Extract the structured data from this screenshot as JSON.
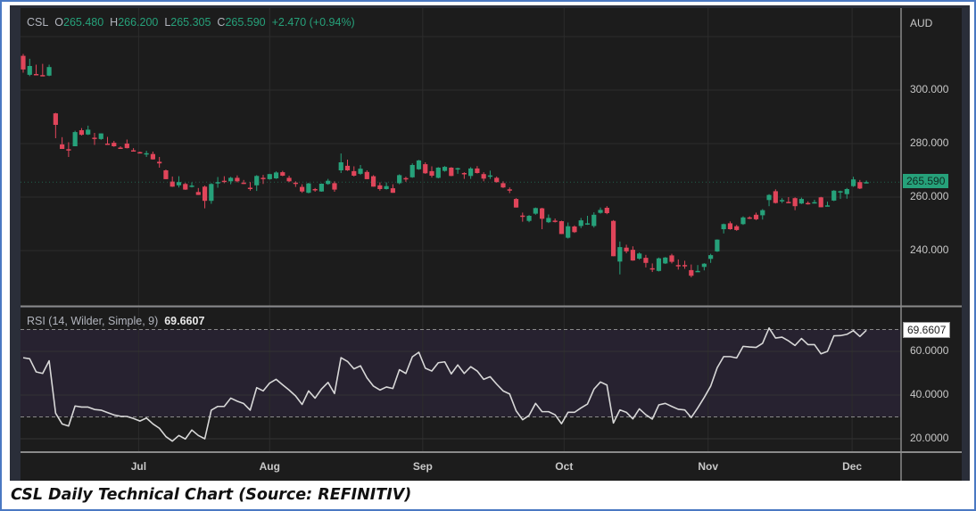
{
  "header": {
    "symbol": "CSL",
    "o_label": "O",
    "open": "265.480",
    "h_label": "H",
    "high": "266.200",
    "l_label": "L",
    "low": "265.305",
    "c_label": "C",
    "close": "265.590",
    "change": "+2.470 (+0.94%)"
  },
  "rsi_header": {
    "label": "RSI (14, Wilder, Simple, 9)",
    "value": "69.6607"
  },
  "caption": "CSL Daily Technical Chart (Source: REFINITIV)",
  "colors": {
    "up": "#26a17a",
    "down": "#e0455a",
    "rsi_line": "#d8d8d8",
    "band": "#272230",
    "bg": "#1c1c1c"
  },
  "chart_data": [
    {
      "type": "candlestick",
      "title": "CSL",
      "currency": "AUD",
      "ylabel": "AUD",
      "ylim": [
        222,
        328
      ],
      "yticks": [
        {
          "v": 300,
          "label": "300.000"
        },
        {
          "v": 280,
          "label": "280.000"
        },
        {
          "v": 260,
          "label": "260.000"
        },
        {
          "v": 240,
          "label": "240.000"
        }
      ],
      "last_price_label": "265.590",
      "last_price": 265.59,
      "xticks": [
        {
          "i": 17.8,
          "label": "Jul"
        },
        {
          "i": 38,
          "label": "Aug"
        },
        {
          "i": 61.6,
          "label": "Sep"
        },
        {
          "i": 83.4,
          "label": "Oct"
        },
        {
          "i": 105.6,
          "label": "Nov"
        },
        {
          "i": 127.8,
          "label": "Dec"
        }
      ],
      "ohlc": [
        [
          312.8,
          313.5,
          306.5,
          307.7
        ],
        [
          305.7,
          311.7,
          305.2,
          309.0
        ],
        [
          306.0,
          309.5,
          305.5,
          305.8
        ],
        [
          305.6,
          309.8,
          305.2,
          305.4
        ],
        [
          305.4,
          309.5,
          305.2,
          308.6
        ],
        [
          291.3,
          291.5,
          282.0,
          287.0
        ],
        [
          279.7,
          282.4,
          278.0,
          278.0
        ],
        [
          277.9,
          280.5,
          275.0,
          277.6
        ],
        [
          279.0,
          284.8,
          279.0,
          284.3
        ],
        [
          285.0,
          285.8,
          283.0,
          283.3
        ],
        [
          283.4,
          286.7,
          283.2,
          285.2
        ],
        [
          282.2,
          284.0,
          279.5,
          281.9
        ],
        [
          281.7,
          283.8,
          281.4,
          283.8
        ],
        [
          280.0,
          282.5,
          279.5,
          279.8
        ],
        [
          280.3,
          281.0,
          278.8,
          279.0
        ],
        [
          278.5,
          279.0,
          278.0,
          278.2
        ],
        [
          280.0,
          281.5,
          278.2,
          278.3
        ],
        [
          277.5,
          278.3,
          277.0,
          277.2
        ],
        [
          276.8,
          277.0,
          276.3,
          276.5
        ],
        [
          276.2,
          277.3,
          275.0,
          276.4
        ],
        [
          276.1,
          277.0,
          274.0,
          274.1
        ],
        [
          273.2,
          275.0,
          271.0,
          272.6
        ],
        [
          270.0,
          270.3,
          266.7,
          266.7
        ],
        [
          265.8,
          267.7,
          263.8,
          263.9
        ],
        [
          264.4,
          267.8,
          263.6,
          265.6
        ],
        [
          264.9,
          265.3,
          262.7,
          262.8
        ],
        [
          264.0,
          265.5,
          263.6,
          264.3
        ],
        [
          261.9,
          263.4,
          260.8,
          260.8
        ],
        [
          263.9,
          264.3,
          255.8,
          258.6
        ],
        [
          258.6,
          265.2,
          257.5,
          264.9
        ],
        [
          265.3,
          267.5,
          263.5,
          265.6
        ],
        [
          266.1,
          267.8,
          265.2,
          265.6
        ],
        [
          265.9,
          267.6,
          264.8,
          267.2
        ],
        [
          267.2,
          268.1,
          265.5,
          265.9
        ],
        [
          265.4,
          266.4,
          264.9,
          265.2
        ],
        [
          263.5,
          265.6,
          262.4,
          263.1
        ],
        [
          264.4,
          268.2,
          262.3,
          267.9
        ],
        [
          267.2,
          268.3,
          264.9,
          266.9
        ],
        [
          266.7,
          268.7,
          266.5,
          268.6
        ],
        [
          267.0,
          269.6,
          266.8,
          269.2
        ],
        [
          269.3,
          269.8,
          267.8,
          268.0
        ],
        [
          267.2,
          268.0,
          265.6,
          265.9
        ],
        [
          265.4,
          265.9,
          263.8,
          265.1
        ],
        [
          263.8,
          264.8,
          261.6,
          262.1
        ],
        [
          261.6,
          265.3,
          261.4,
          265.1
        ],
        [
          263.0,
          263.4,
          262.0,
          262.7
        ],
        [
          262.1,
          265.1,
          262.0,
          265.0
        ],
        [
          264.9,
          266.8,
          264.6,
          266.1
        ],
        [
          265.2,
          265.9,
          262.0,
          262.8
        ],
        [
          270.0,
          276.3,
          269.0,
          273.0
        ],
        [
          271.7,
          274.0,
          269.8,
          270.0
        ],
        [
          269.7,
          271.5,
          267.7,
          268.0
        ],
        [
          268.7,
          272.0,
          268.3,
          270.6
        ],
        [
          269.4,
          270.0,
          266.7,
          266.7
        ],
        [
          267.8,
          268.2,
          263.9,
          263.9
        ],
        [
          264.4,
          265.5,
          262.4,
          263.0
        ],
        [
          263.0,
          265.5,
          262.8,
          264.1
        ],
        [
          263.3,
          264.8,
          261.6,
          261.6
        ],
        [
          265.2,
          268.5,
          264.8,
          268.2
        ],
        [
          267.1,
          267.6,
          265.7,
          266.9
        ],
        [
          267.4,
          272.6,
          267.2,
          272.0
        ],
        [
          270.4,
          273.9,
          270.2,
          273.7
        ],
        [
          272.3,
          273.0,
          268.7,
          268.9
        ],
        [
          269.7,
          271.5,
          267.3,
          268.0
        ],
        [
          267.2,
          271.2,
          267.0,
          271.0
        ],
        [
          269.8,
          271.6,
          269.5,
          271.3
        ],
        [
          271.0,
          271.2,
          267.8,
          267.9
        ],
        [
          270.6,
          271.0,
          268.7,
          270.8
        ],
        [
          269.0,
          269.3,
          266.8,
          268.9
        ],
        [
          267.9,
          271.2,
          266.8,
          270.7
        ],
        [
          270.7,
          271.6,
          268.8,
          269.0
        ],
        [
          268.6,
          269.3,
          265.9,
          266.9
        ],
        [
          267.9,
          269.9,
          266.8,
          268.1
        ],
        [
          267.2,
          267.7,
          265.4,
          265.6
        ],
        [
          265.2,
          265.9,
          263.4,
          263.6
        ],
        [
          262.9,
          263.6,
          261.5,
          262.7
        ],
        [
          259.3,
          259.6,
          256.1,
          256.1
        ],
        [
          253.1,
          254.2,
          250.8,
          252.8
        ],
        [
          251.1,
          253.3,
          250.6,
          253.0
        ],
        [
          253.8,
          256.1,
          253.4,
          255.9
        ],
        [
          255.8,
          256.0,
          248.0,
          251.9
        ],
        [
          250.6,
          253.5,
          250.3,
          252.2
        ],
        [
          251.2,
          252.0,
          250.5,
          251.0
        ],
        [
          251.0,
          251.2,
          246.2,
          246.2
        ],
        [
          244.8,
          250.5,
          244.5,
          249.1
        ],
        [
          249.0,
          249.4,
          246.6,
          246.9
        ],
        [
          249.2,
          252.2,
          248.4,
          251.3
        ],
        [
          250.1,
          253.0,
          249.6,
          250.2
        ],
        [
          249.2,
          254.3,
          248.6,
          253.4
        ],
        [
          254.1,
          256.1,
          253.8,
          255.2
        ],
        [
          256.0,
          256.6,
          253.6,
          254.0
        ],
        [
          251.1,
          251.4,
          237.9,
          237.9
        ],
        [
          235.9,
          243.4,
          231.1,
          241.3
        ],
        [
          241.1,
          242.2,
          239.0,
          239.7
        ],
        [
          240.3,
          241.6,
          236.2,
          236.3
        ],
        [
          237.0,
          239.3,
          236.6,
          238.9
        ],
        [
          237.3,
          238.4,
          233.7,
          235.4
        ],
        [
          233.4,
          235.2,
          232.0,
          233.0
        ],
        [
          232.4,
          237.4,
          232.2,
          237.1
        ],
        [
          235.2,
          237.6,
          235.0,
          237.4
        ],
        [
          238.2,
          238.8,
          235.2,
          235.8
        ],
        [
          234.6,
          236.7,
          232.9,
          234.3
        ],
        [
          234.6,
          236.2,
          233.2,
          234.3
        ],
        [
          232.7,
          234.8,
          230.0,
          230.6
        ],
        [
          232.2,
          234.6,
          232.0,
          232.4
        ],
        [
          233.9,
          235.3,
          232.6,
          235.1
        ],
        [
          236.9,
          238.8,
          235.4,
          238.3
        ],
        [
          239.7,
          244.2,
          239.5,
          244.1
        ],
        [
          248.0,
          250.1,
          246.4,
          249.9
        ],
        [
          250.2,
          250.9,
          247.8,
          248.0
        ],
        [
          249.1,
          249.6,
          247.4,
          247.7
        ],
        [
          249.9,
          252.8,
          249.6,
          252.4
        ],
        [
          252.4,
          252.8,
          251.8,
          252.2
        ],
        [
          253.4,
          254.2,
          251.4,
          251.7
        ],
        [
          253.2,
          255.5,
          251.6,
          255.1
        ],
        [
          258.9,
          261.1,
          256.6,
          260.8
        ],
        [
          262.2,
          262.9,
          257.6,
          257.8
        ],
        [
          258.8,
          259.6,
          257.8,
          258.9
        ],
        [
          258.2,
          260.0,
          257.7,
          258.0
        ],
        [
          259.6,
          259.9,
          255.1,
          256.6
        ],
        [
          257.6,
          259.8,
          257.4,
          259.3
        ],
        [
          257.8,
          258.4,
          257.2,
          257.4
        ],
        [
          258.0,
          259.0,
          257.6,
          258.1
        ],
        [
          259.9,
          260.1,
          256.2,
          256.2
        ],
        [
          256.7,
          258.3,
          256.5,
          256.9
        ],
        [
          258.7,
          262.6,
          258.5,
          262.4
        ],
        [
          262.0,
          262.4,
          259.3,
          262.2
        ],
        [
          261.1,
          263.4,
          259.4,
          263.0
        ],
        [
          264.1,
          267.6,
          263.8,
          266.6
        ],
        [
          265.6,
          266.4,
          263.0,
          263.2
        ],
        [
          265.48,
          266.2,
          265.305,
          265.59
        ]
      ]
    },
    {
      "type": "line",
      "title": "RSI (14, Wilder, Simple, 9)",
      "ylim": [
        12,
        78
      ],
      "yticks": [
        {
          "v": 60,
          "label": "60.0000"
        },
        {
          "v": 40,
          "label": "40.0000"
        },
        {
          "v": 20,
          "label": "20.0000"
        }
      ],
      "bands": [
        30,
        70
      ],
      "last_value_label": "69.6607",
      "values": [
        57.1,
        56.6,
        50.6,
        49.9,
        55.7,
        31.7,
        26.8,
        25.8,
        35,
        34.5,
        34.5,
        33.4,
        33.1,
        32,
        30.9,
        30.3,
        30.2,
        29.3,
        28.1,
        29.5,
        26.8,
        24.8,
        21,
        18.9,
        21.5,
        19.9,
        24,
        21.5,
        20,
        33.1,
        34.8,
        34.8,
        38.6,
        37.2,
        36.1,
        33.1,
        43.4,
        41.9,
        45.5,
        47.2,
        44.7,
        42.3,
        39.6,
        35.7,
        41.9,
        38.6,
        42.8,
        45.8,
        40.7,
        57.1,
        55.4,
        52,
        53.4,
        47.9,
        44.1,
        42.3,
        43.7,
        43,
        51.6,
        49.9,
        57.5,
        59.6,
        52.3,
        51,
        54.8,
        55.2,
        49.7,
        53.8,
        49.9,
        53,
        51,
        47.2,
        48.4,
        45,
        41.9,
        40.5,
        32.8,
        28.7,
        30.7,
        36.2,
        32.4,
        32.4,
        31,
        26.9,
        32.1,
        32.1,
        34.1,
        35.9,
        42.7,
        46,
        44.6,
        27.2,
        33.2,
        32.1,
        29.1,
        33.7,
        31,
        29,
        35.5,
        36.2,
        34.8,
        33.5,
        33.2,
        29.7,
        34.1,
        38.9,
        44.1,
        52.5,
        57.6,
        57.6,
        57,
        62.3,
        62,
        61.8,
        63.7,
        70.7,
        66.1,
        66.5,
        64.8,
        62.7,
        65.9,
        63.1,
        63.1,
        58.9,
        60,
        67.1,
        67.2,
        67.8,
        69.5,
        66.8,
        69.66
      ]
    }
  ]
}
